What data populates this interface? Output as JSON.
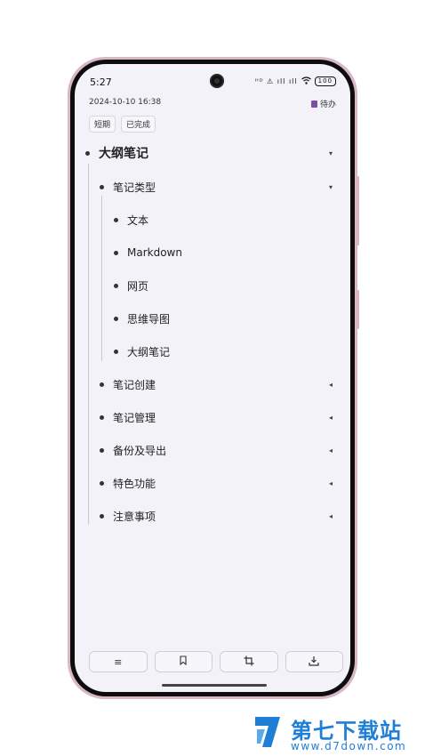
{
  "status_bar": {
    "time": "5:27",
    "icons_text": "ᴴᴰ ⚠ ıll ıll",
    "battery": "100"
  },
  "note": {
    "date": "2024-10-10 16:38",
    "todo_label": "待办",
    "tags": [
      "短期",
      "已完成"
    ]
  },
  "outline": {
    "root": "大纲笔记",
    "level1": {
      "type_heading": "笔记类型",
      "type_children": [
        "文本",
        "Markdown",
        "网页",
        "思维导图",
        "大纲笔记"
      ],
      "siblings": [
        "笔记创建",
        "笔记管理",
        "备份及导出",
        "特色功能",
        "注意事项"
      ]
    },
    "expanded_arrow": "▾",
    "collapsed_arrow": "◂"
  },
  "toolbar": {
    "buttons": [
      {
        "name": "list-button",
        "glyph": "≡"
      },
      {
        "name": "bookmark-button",
        "glyph": "⌑"
      },
      {
        "name": "crop-button",
        "glyph": "⌗"
      },
      {
        "name": "download-button",
        "glyph": "⤓"
      }
    ]
  },
  "watermark": {
    "title": "第七下载站",
    "url": "www.d7down.com",
    "brand_color": "#1f7ed6"
  }
}
